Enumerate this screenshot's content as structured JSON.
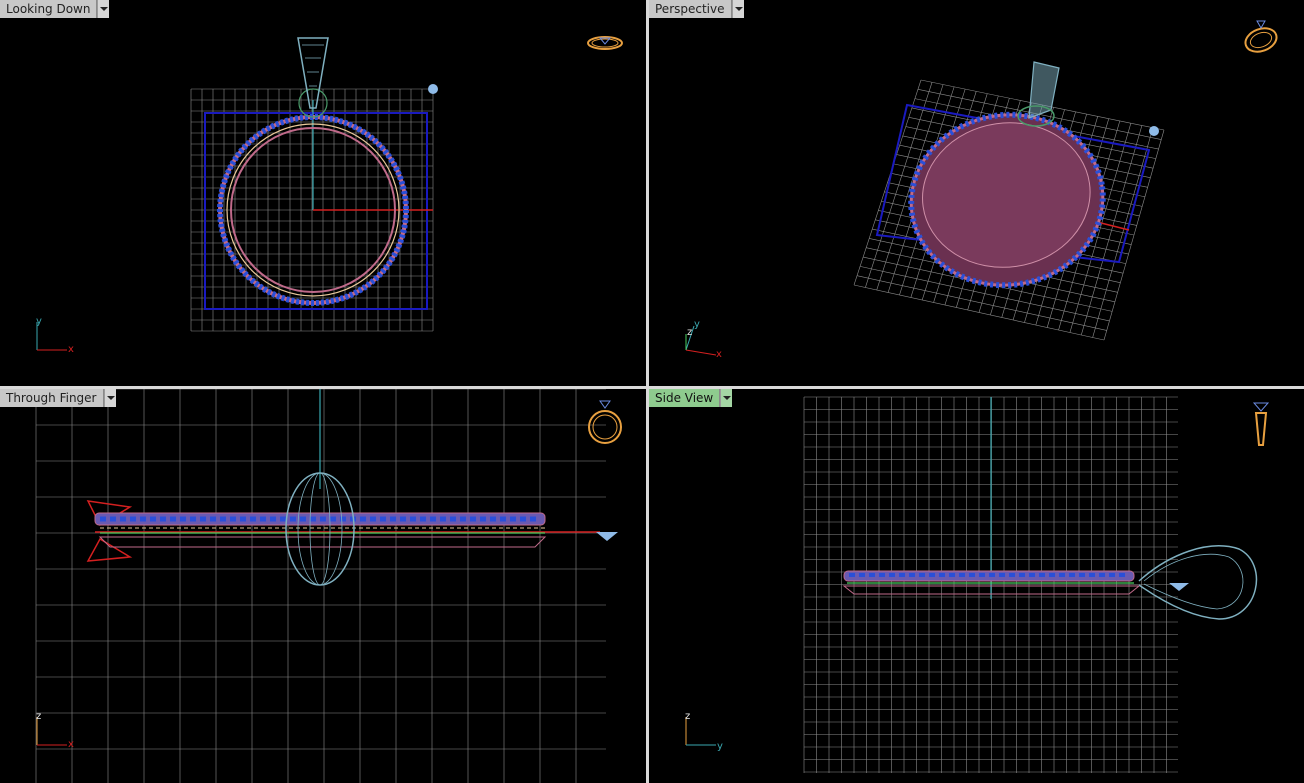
{
  "viewports": {
    "top_left": {
      "label": "Looking Down",
      "axis_h": "x",
      "axis_v": "y"
    },
    "top_right": {
      "label": "Perspective",
      "axis_h": "x",
      "axis_v": "y",
      "axis_z": "z"
    },
    "bottom_left": {
      "label": "Through Finger",
      "axis_h": "x",
      "axis_v": "z"
    },
    "bottom_right": {
      "label": "Side View",
      "axis_h": "y",
      "axis_v": "z"
    }
  },
  "active_viewport": "Side View",
  "icons": {
    "view_cube": "ring-view-gizmo-icon",
    "menu": "chevron-down-icon"
  },
  "colors": {
    "background": "#000000",
    "grid": "#8c8c8c",
    "grid_major": "#1a1aa0",
    "axis_x": "#d42020",
    "axis_y": "#3aa8b0",
    "model_wire": "#7fb0c0",
    "stones": "#2a4fd8",
    "metal": "#c06a8a",
    "gizmo": "#e8a040",
    "active_tab": "#8ecb8e"
  }
}
